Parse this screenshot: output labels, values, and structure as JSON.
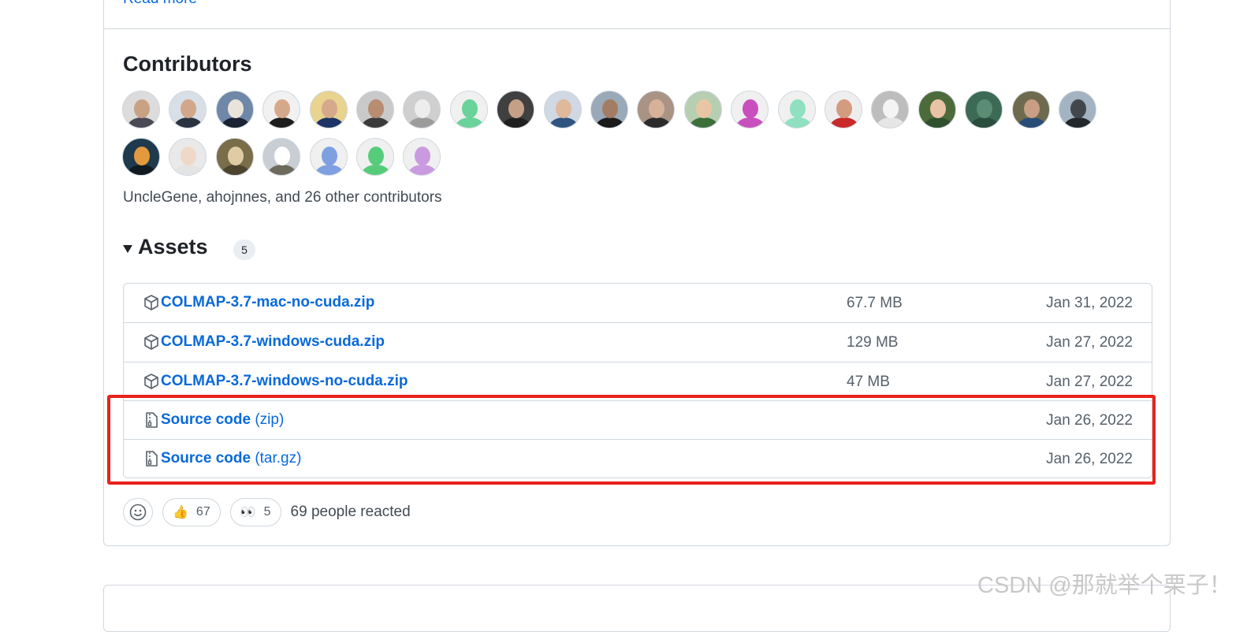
{
  "release": {
    "read_more_label": "Read more"
  },
  "contributors": {
    "title": "Contributors",
    "summary": "UncleGene, ahojnnes, and 26 other contributors",
    "avatars": [
      {
        "bg": "#dcdcdc",
        "face": "#c9a183",
        "body": "#4a4a55"
      },
      {
        "bg": "#d9dfe6",
        "face": "#d1a78c",
        "body": "#2c3340"
      },
      {
        "bg": "#6f87a8",
        "face": "#e9e3da",
        "body": "#1a2233"
      },
      {
        "bg": "#f1f1f1",
        "face": "#d6a88a",
        "body": "#1d1d1d"
      },
      {
        "bg": "#e8d38f",
        "face": "#d6a98a",
        "body": "#1d3466"
      },
      {
        "bg": "#c9c9c9",
        "face": "#b78c70",
        "body": "#3a3a3a"
      },
      {
        "bg": "#cfcfcf",
        "face": "#ededed",
        "body": "#9c9c9c"
      },
      {
        "bg": "#f0f0f0",
        "face": "#6ad39a",
        "body": "#6ad39a"
      },
      {
        "bg": "#404040",
        "face": "#c5a087",
        "body": "#202020"
      },
      {
        "bg": "#cfd8e3",
        "face": "#e0b89a",
        "body": "#2e5580"
      },
      {
        "bg": "#9aa9b8",
        "face": "#a37d63",
        "body": "#1b1b1b"
      },
      {
        "bg": "#a89384",
        "face": "#d7b299",
        "body": "#2b2b2b"
      },
      {
        "bg": "#b6cfb0",
        "face": "#e8c6a4",
        "body": "#3d6f3a"
      },
      {
        "bg": "#f0f0f0",
        "face": "#c94fbe",
        "body": "#c94fbe"
      },
      {
        "bg": "#f0f0f0",
        "face": "#8ee0c0",
        "body": "#8ee0c0"
      },
      {
        "bg": "#eeeeee",
        "face": "#d39b80",
        "body": "#c82a2a"
      },
      {
        "bg": "#bdbdbd",
        "face": "#f4f4f4",
        "body": "#e6e6e6"
      },
      {
        "bg": "#4d6b3a",
        "face": "#e8c3a5",
        "body": "#2f4f2f"
      },
      {
        "bg": "#3c6a55",
        "face": "#5b8d74",
        "body": "#2b4d3d"
      },
      {
        "bg": "#6f6a4f",
        "face": "#c89e84",
        "body": "#2a4d78"
      },
      {
        "bg": "#a4b3c2",
        "face": "#42474d",
        "body": "#23272b"
      },
      {
        "bg": "#1f3a4d",
        "face": "#e39a3e",
        "body": "#101a20"
      },
      {
        "bg": "#e9e9e9",
        "face": "#efd8c8",
        "body": "#e4e4e4"
      },
      {
        "bg": "#7a6d4a",
        "face": "#e0cba4",
        "body": "#4d4430"
      },
      {
        "bg": "#c8ced3",
        "face": "#ffffff",
        "body": "#6d6a5c"
      },
      {
        "bg": "#f0f0f0",
        "face": "#7fa0e0",
        "body": "#7fa0e0"
      },
      {
        "bg": "#f0f0f0",
        "face": "#56cc7a",
        "body": "#56cc7a"
      },
      {
        "bg": "#f0f0f0",
        "face": "#c99ae0",
        "body": "#c99ae0"
      }
    ]
  },
  "assets": {
    "title": "Assets",
    "count": "5",
    "rows": [
      {
        "name": "COLMAP-3.7-mac-no-cuda.zip",
        "sub": "",
        "size": "67.7 MB",
        "date": "Jan 31, 2022",
        "icon": "package-icon"
      },
      {
        "name": "COLMAP-3.7-windows-cuda.zip",
        "sub": "",
        "size": "129 MB",
        "date": "Jan 27, 2022",
        "icon": "package-icon"
      },
      {
        "name": "COLMAP-3.7-windows-no-cuda.zip",
        "sub": "",
        "size": "47 MB",
        "date": "Jan 27, 2022",
        "icon": "package-icon"
      },
      {
        "name": "Source code",
        "sub": " (zip)",
        "size": "",
        "date": "Jan 26, 2022",
        "icon": "file-zip-icon"
      },
      {
        "name": "Source code",
        "sub": " (tar.gz)",
        "size": "",
        "date": "Jan 26, 2022",
        "icon": "file-zip-icon"
      }
    ]
  },
  "reactions": {
    "thumbs_emoji": "👍",
    "thumbs_count": "67",
    "eyes_emoji": "👀",
    "eyes_count": "5",
    "summary": "69 people reacted"
  },
  "watermark": "CSDN @那就举个栗子！",
  "colors": {
    "link": "#0969da",
    "border": "#d0d7de",
    "highlight": "#e8221b"
  }
}
